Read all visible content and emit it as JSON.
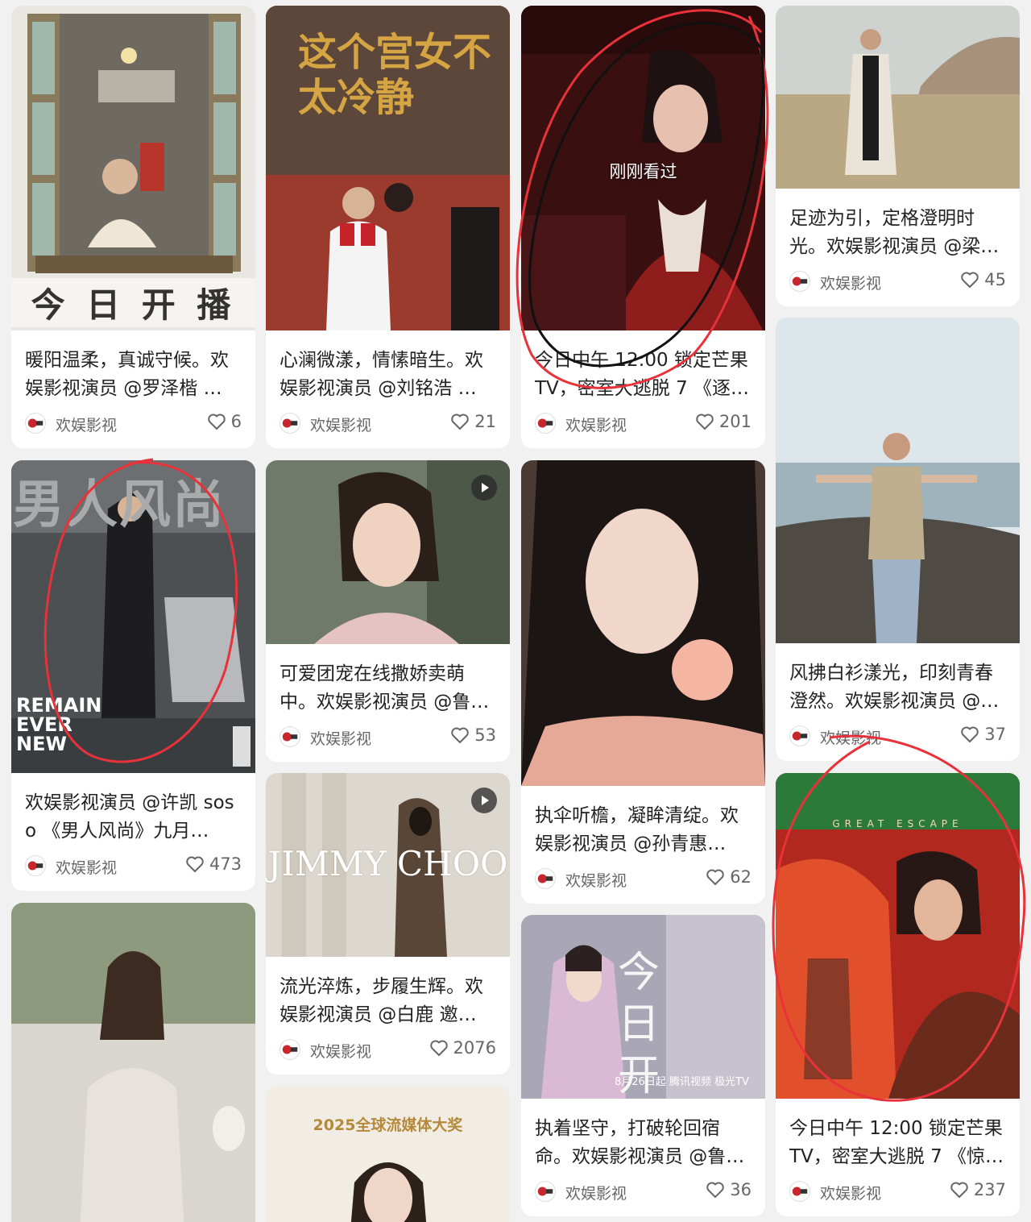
{
  "author_name": "欢娱影视",
  "icons": {
    "like": "heart-icon",
    "avatar": "huanyu-logo-icon",
    "video": "play-icon"
  },
  "colors": {
    "background": "#f1f1f2",
    "card": "#ffffff",
    "text": "#222222",
    "muted": "#666666",
    "annotation_red": "#e8323a"
  },
  "cards": [
    {
      "title": "暖阳温柔，真诚守候。欢娱影视演员 @罗泽楷 …",
      "likes": "6",
      "poster_text": "今 日 开 播"
    },
    {
      "title": "心澜微漾，情愫暗生。欢娱影视演员 @刘铭浩 …",
      "likes": "21",
      "poster_text": "这个宫女不太冷静"
    },
    {
      "title": "今日中午 12:00 锁定芒果 TV，密室大逃脱 7 《逐光…",
      "likes": "201",
      "overlay": "刚刚看过"
    },
    {
      "title": "足迹为引，定格澄明时光。欢娱影视演员 @梁…",
      "likes": "45"
    },
    {
      "title": "欢娱影视演员 @许凯 soso 《男人风尚》九月…",
      "likes": "473",
      "poster_text": "男人风尚",
      "poster_sub": "REMAIN EVER NEW"
    },
    {
      "title": "可爱团宠在线撒娇卖萌中。欢娱影视演员 @鲁…",
      "likes": "53"
    },
    {
      "title": "执伞听檐，凝眸清绽。欢娱影视演员 @孙青惠…",
      "likes": "62"
    },
    {
      "title": "风拂白衫漾光，印刻青春澄然。欢娱影视演员 @…",
      "likes": "37"
    },
    {
      "title": "流光淬炼，步履生辉。欢娱影视演员 @白鹿 邀…",
      "likes": "2076",
      "poster_text": "JIMMY CHOO"
    },
    {
      "title": "执着坚守，打破轮回宿命。欢娱影视演员 @鲁…",
      "likes": "36",
      "poster_text": "今日开播",
      "poster_sub": "8月26日起 腾讯视频 极光TV"
    },
    {
      "title": "今日中午 12:00 锁定芒果 TV，密室大逃脱 7 《惊…",
      "likes": "237",
      "poster_text": "GREAT ESCAPE"
    },
    {
      "poster_text": "2025全球流媒体大奖"
    }
  ]
}
